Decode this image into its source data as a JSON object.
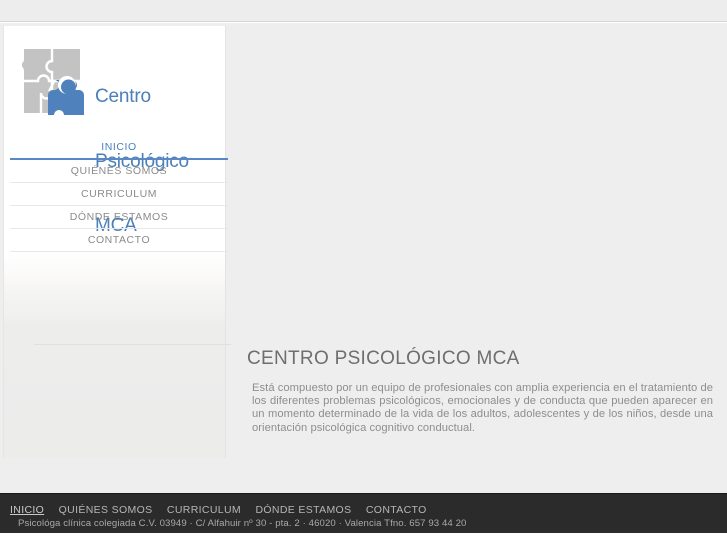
{
  "site": {
    "logo": {
      "icon": "puzzle-logo-icon",
      "line1": "Centro",
      "line2": "Psicológico",
      "line3": "MCA",
      "brand_blue": "#4a7fba",
      "puzzle_gray": "#c3c3c3"
    }
  },
  "sidebar": {
    "nav": [
      {
        "label": "INICIO",
        "active": true
      },
      {
        "label": "QUIÉNES SOMOS",
        "active": false
      },
      {
        "label": "CURRICULUM",
        "active": false
      },
      {
        "label": "DÓNDE ESTAMOS",
        "active": false
      },
      {
        "label": "CONTACTO",
        "active": false
      }
    ]
  },
  "main": {
    "title": "CENTRO PSICOLÓGICO MCA",
    "paragraph": "Está compuesto por un equipo de profesionales con amplia experiencia en el tratamiento de los diferentes problemas psicológicos, emocionales y de conducta que pueden aparecer en un momento determinado de la vida de los adultos, adolescentes y de los niños, desde una orientación psicológica cognitivo conductual."
  },
  "footer": {
    "nav": [
      {
        "label": "INICIO",
        "active": true
      },
      {
        "label": "QUIÉNES SOMOS",
        "active": false
      },
      {
        "label": "CURRICULUM",
        "active": false
      },
      {
        "label": "DÓNDE ESTAMOS",
        "active": false
      },
      {
        "label": "CONTACTO",
        "active": false
      }
    ],
    "legal": "Psicológa clínica colegiada C.V. 03949 · C/ Alfahuir nº 30 - pta. 2 · 46020 · Valencia Tfno. 657 93 44 20",
    "background": "#2b2b2b"
  }
}
